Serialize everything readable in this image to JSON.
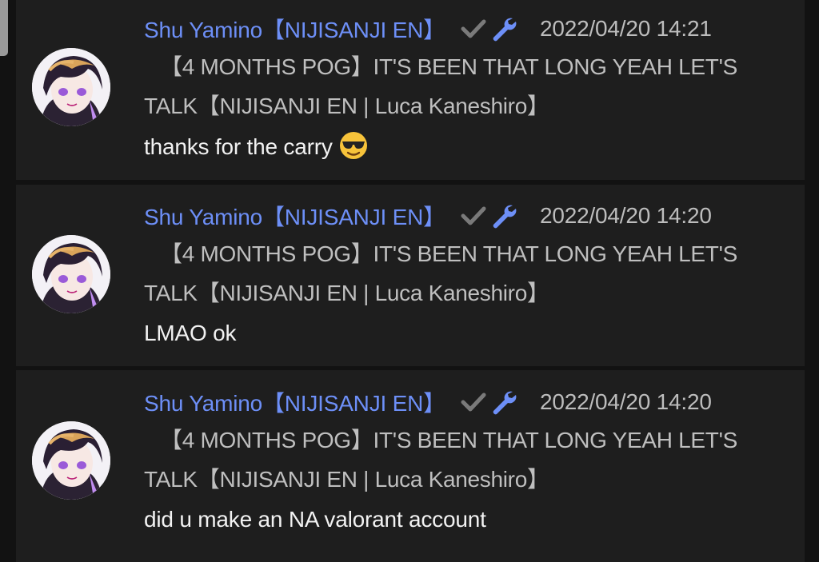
{
  "messages": [
    {
      "author": "Shu Yamino【NIJISANJI EN】",
      "timestamp": "2022/04/20 14:21",
      "video_title_line1": "【4 MONTHS POG】IT'S BEEN THAT LONG YEAH LET'S",
      "video_title_line2": "TALK【NIJISANJI EN | Luca Kaneshiro】",
      "text": "thanks for the carry",
      "emoji": "smiling-face-with-sunglasses-icon"
    },
    {
      "author": "Shu Yamino【NIJISANJI EN】",
      "timestamp": "2022/04/20 14:20",
      "video_title_line1": "【4 MONTHS POG】IT'S BEEN THAT LONG YEAH LET'S",
      "video_title_line2": "TALK【NIJISANJI EN | Luca Kaneshiro】",
      "text": "LMAO ok"
    },
    {
      "author": "Shu Yamino【NIJISANJI EN】",
      "timestamp": "2022/04/20 14:20",
      "video_title_line1": "【4 MONTHS POG】IT'S BEEN THAT LONG YEAH LET'S",
      "video_title_line2": "TALK【NIJISANJI EN | Luca Kaneshiro】",
      "text": "did u make an NA valorant account"
    }
  ],
  "colors": {
    "background": "#121212",
    "card": "#1e1e1e",
    "author": "#6d8ff7",
    "verified_check": "#7a7a7a",
    "wrench": "#6d8ff7",
    "meta_text": "#bdbdbd",
    "message_text": "#f2f2f2"
  },
  "icons": [
    "avatar",
    "checkmark-verified-icon",
    "wrench-moderator-icon",
    "smiling-face-with-sunglasses-icon"
  ]
}
